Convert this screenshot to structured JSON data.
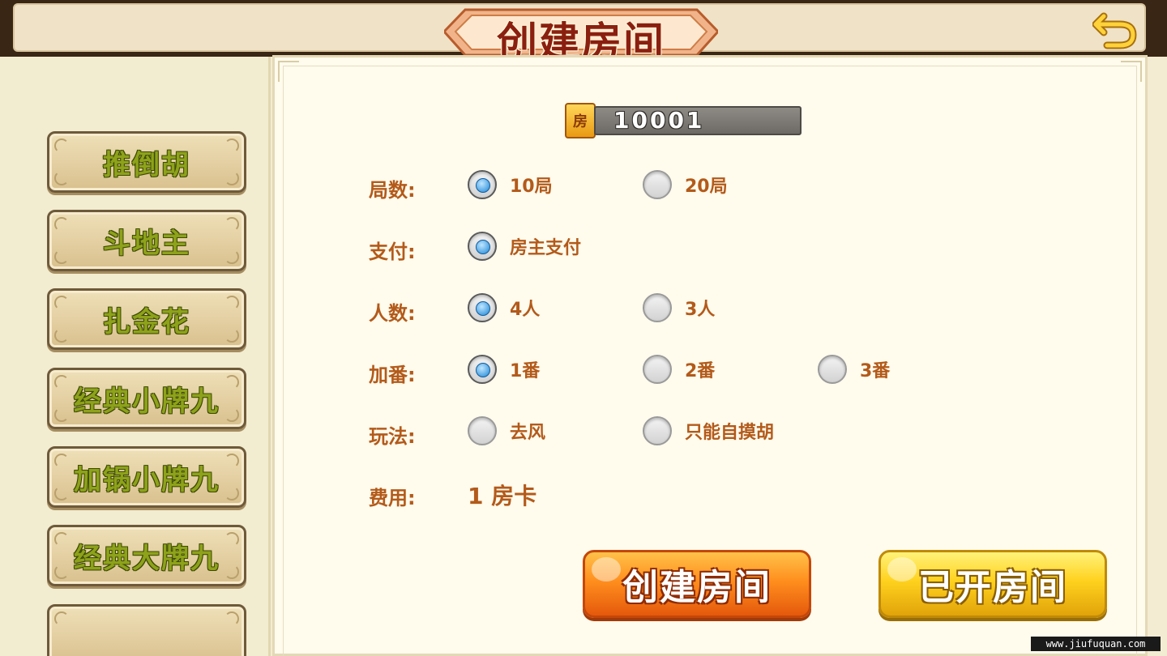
{
  "header": {
    "title": "创建房间",
    "back_icon": "back-arrow-icon"
  },
  "sidebar": {
    "items": [
      {
        "label": "推倒胡"
      },
      {
        "label": "斗地主"
      },
      {
        "label": "扎金花"
      },
      {
        "label": "经典小牌九"
      },
      {
        "label": "加锅小牌九"
      },
      {
        "label": "经典大牌九"
      },
      {
        "label": ""
      }
    ]
  },
  "room": {
    "icon_text": "房",
    "id": "10001"
  },
  "options": {
    "rounds": {
      "label": "局数:",
      "choices": [
        {
          "text": "10局",
          "selected": true
        },
        {
          "text": "20局",
          "selected": false
        }
      ]
    },
    "payment": {
      "label": "支付:",
      "choices": [
        {
          "text": "房主支付",
          "selected": true
        }
      ]
    },
    "players": {
      "label": "人数:",
      "choices": [
        {
          "text": "4人",
          "selected": true
        },
        {
          "text": "3人",
          "selected": false
        }
      ]
    },
    "bonus": {
      "label": "加番:",
      "choices": [
        {
          "text": "1番",
          "selected": true
        },
        {
          "text": "2番",
          "selected": false
        },
        {
          "text": "3番",
          "selected": false
        }
      ]
    },
    "rules": {
      "label": "玩法:",
      "choices": [
        {
          "text": "去风",
          "selected": false
        },
        {
          "text": "只能自摸胡",
          "selected": false
        }
      ]
    },
    "cost": {
      "label": "费用:",
      "value": "1 房卡"
    }
  },
  "buttons": {
    "create": "创建房间",
    "opened": "已开房间"
  },
  "watermark": "www.jiufuquan.com",
  "colors": {
    "label": "#b35a1a",
    "title": "#8a1f10",
    "sidebar_text": "#8ea21a",
    "create_button": "#ff8f1e",
    "opened_button": "#ffd21e",
    "radio_selected": "#1b86d6"
  }
}
